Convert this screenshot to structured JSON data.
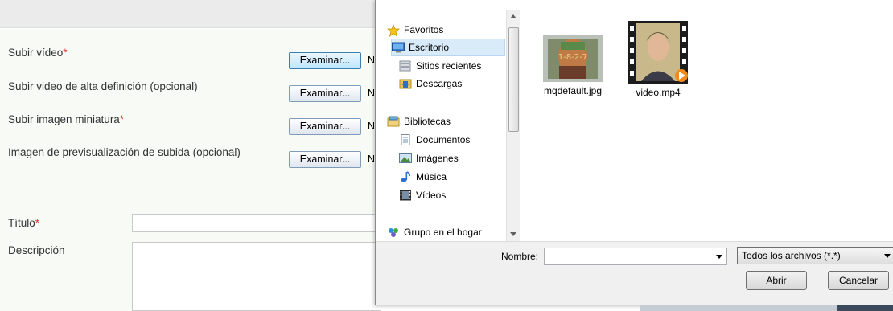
{
  "form": {
    "upload_video_label": "Subir vídeo",
    "upload_hd_label": "Subir video de alta definición (opcional)",
    "upload_thumb_label": "Subir imagen miniatura",
    "preview_image_label": "Imagen de previsualización de subida (opcional)",
    "title_label": "Título",
    "description_label": "Descripción",
    "required_mark": "*",
    "browse_label": "Examinar...",
    "browse_tail": "N"
  },
  "dialog": {
    "nav": {
      "favorites": "Favoritos",
      "desktop": "Escritorio",
      "recent": "Sitios recientes",
      "downloads": "Descargas",
      "libraries": "Bibliotecas",
      "documents": "Documentos",
      "images": "Imágenes",
      "music": "Música",
      "videos": "Vídeos",
      "homegroup": "Grupo en el hogar"
    },
    "files": [
      {
        "name": "mqdefault.jpg",
        "overlay": "1-8-2-7"
      },
      {
        "name": "video.mp4"
      }
    ],
    "filename_label": "Nombre:",
    "filename_value": "",
    "filter_value": "Todos los archivos (*.*)",
    "open_label": "Abrir",
    "cancel_label": "Cancelar"
  },
  "colors": {
    "required": "#dd3333",
    "selected_bg": "#d9ebf9",
    "form_bg": "#f8faf6"
  }
}
